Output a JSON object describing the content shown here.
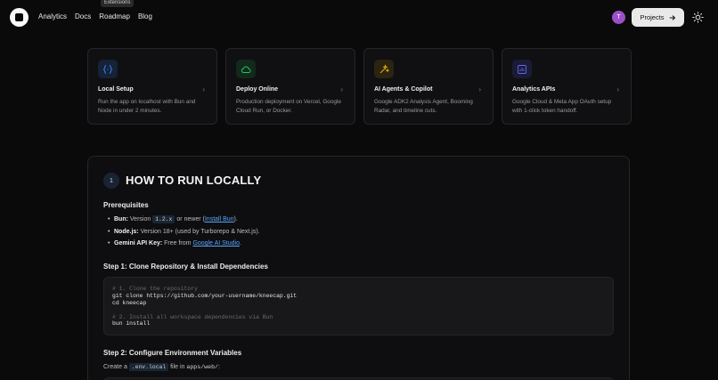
{
  "nav": {
    "links": [
      "Analytics",
      "Docs",
      "Roadmap",
      "Blog"
    ],
    "tooltip": "Extensions",
    "avatar_initial": "T",
    "projects_label": "Projects"
  },
  "cards": [
    {
      "title": "Local Setup",
      "desc": "Run the app on localhost with Bun and Node in under 2 minutes.",
      "icon": "code-braces-icon",
      "color": "#3b82f6"
    },
    {
      "title": "Deploy Online",
      "desc": "Production deployment on Vercel, Google Cloud Run, or Docker.",
      "icon": "cloud-icon",
      "color": "#22c55e"
    },
    {
      "title": "AI Agents & Copilot",
      "desc": "Google ADK2 Analysis Agent, Booming Radar, and timeline cuts.",
      "icon": "sparkles-icon",
      "color": "#eab308"
    },
    {
      "title": "Analytics APIs",
      "desc": "Google Cloud & Meta App OAuth setup with 1-click token handoff.",
      "icon": "chart-icon",
      "color": "#6366f1"
    }
  ],
  "section": {
    "number": "1",
    "title": "HOW TO RUN LOCALLY",
    "prereq_heading": "Prerequisites",
    "prereqs": {
      "bun_label": "Bun:",
      "bun_text_1": " Version ",
      "bun_version": "1.2.x",
      "bun_text_2": " or newer (",
      "bun_link": "Install Bun",
      "bun_text_3": ").",
      "node_label": "Node.js:",
      "node_text": " Version 18+ (used by Turborepo & Next.js).",
      "gemini_label": "Gemini API Key:",
      "gemini_text": " Free from ",
      "gemini_link": "Google AI Studio",
      "gemini_end": "."
    },
    "step1_heading": "Step 1: Clone Repository & Install Dependencies",
    "code_lines": [
      {
        "type": "comment",
        "text": "# 1. Clone the repository"
      },
      {
        "type": "code",
        "text": "git clone https://github.com/your-username/kneecap.git"
      },
      {
        "type": "code",
        "text": "cd kneecap"
      },
      {
        "type": "blank",
        "text": ""
      },
      {
        "type": "comment",
        "text": "# 2. Install all workspace dependencies via Bun"
      },
      {
        "type": "code",
        "text": "bun install"
      }
    ],
    "step2_heading": "Step 2: Configure Environment Variables",
    "step2_text_1": "Create a ",
    "step2_file": ".env.local",
    "step2_text_2": " file in ",
    "step2_path": "apps/web/",
    "step2_text_3": ":"
  }
}
